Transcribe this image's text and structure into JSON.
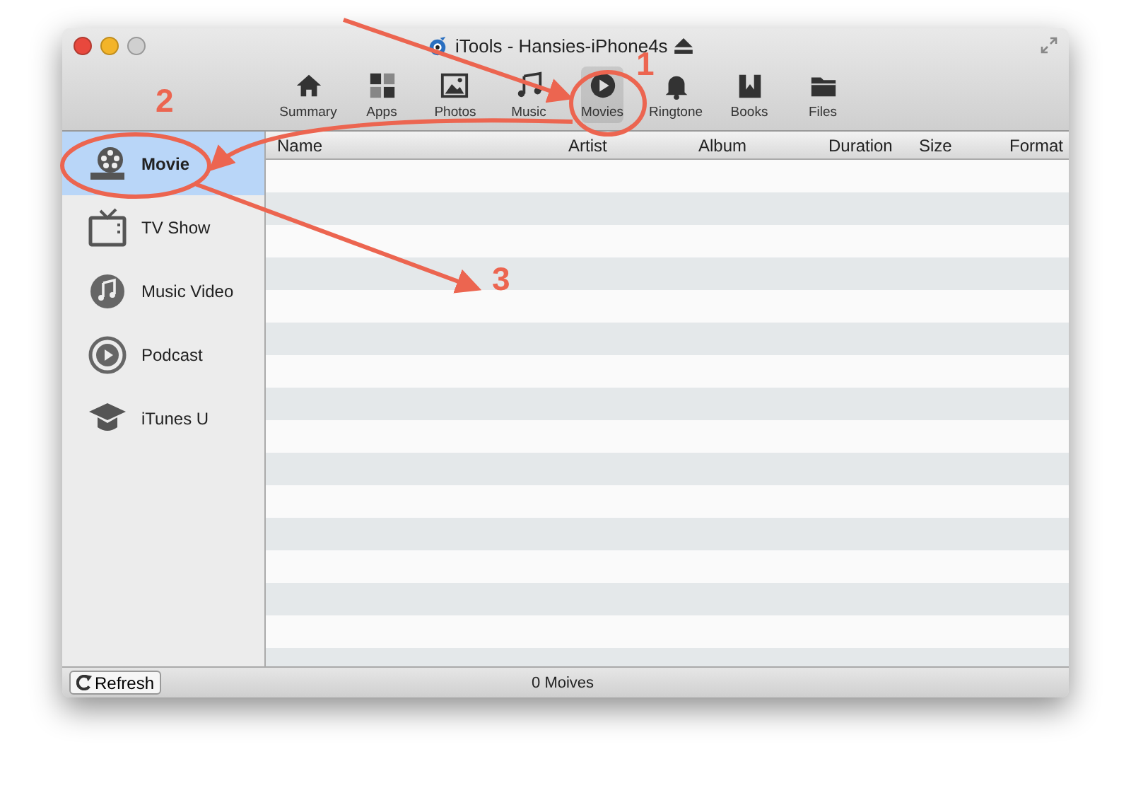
{
  "window": {
    "title": "iTools - Hansies-iPhone4s"
  },
  "toolbar": [
    {
      "label": "Summary",
      "selected": false
    },
    {
      "label": "Apps",
      "selected": false
    },
    {
      "label": "Photos",
      "selected": false
    },
    {
      "label": "Music",
      "selected": false
    },
    {
      "label": "Movies",
      "selected": true
    },
    {
      "label": "Ringtone",
      "selected": false
    },
    {
      "label": "Books",
      "selected": false
    },
    {
      "label": "Files",
      "selected": false
    }
  ],
  "sidebar": {
    "items": [
      {
        "label": "Movie",
        "selected": true
      },
      {
        "label": "TV Show",
        "selected": false
      },
      {
        "label": "Music Video",
        "selected": false
      },
      {
        "label": "Podcast",
        "selected": false
      },
      {
        "label": "iTunes U",
        "selected": false
      }
    ]
  },
  "table": {
    "columns": [
      "Name",
      "Artist",
      "Album",
      "Duration",
      "Size",
      "Format"
    ]
  },
  "status_bar": {
    "button": "Refresh",
    "text": "0 Moives"
  },
  "annotations": [
    {
      "label": "1"
    },
    {
      "label": "2"
    },
    {
      "label": "3"
    }
  ]
}
